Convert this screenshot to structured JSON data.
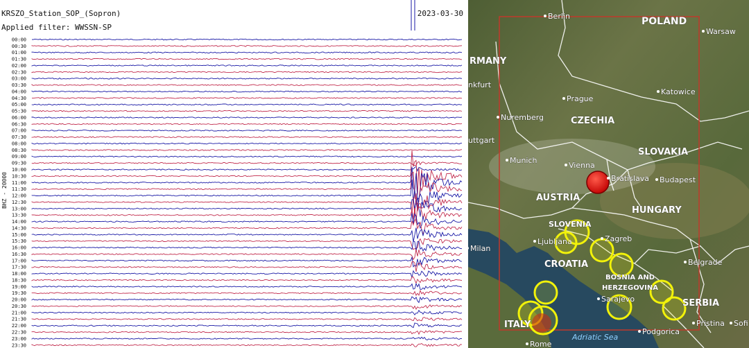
{
  "seismogram": {
    "station": "KRSZO_Station_SOP_(Sopron)",
    "filter": "Applied filter: WWSSN-SP",
    "date": "2023-03-30",
    "y_axis_label": "BHZ - 20000",
    "trace_colors": [
      "#1a1aa6",
      "#c22b4d"
    ],
    "time_labels": [
      "00:00",
      "00:30",
      "01:00",
      "01:30",
      "02:00",
      "02:30",
      "03:00",
      "03:30",
      "04:00",
      "04:30",
      "05:00",
      "05:30",
      "06:00",
      "06:30",
      "07:00",
      "07:30",
      "08:00",
      "08:30",
      "09:00",
      "09:30",
      "10:00",
      "10:30",
      "11:00",
      "11:30",
      "12:00",
      "12:30",
      "13:00",
      "13:30",
      "14:00",
      "14:30",
      "15:00",
      "15:30",
      "16:00",
      "16:30",
      "17:00",
      "17:30",
      "18:00",
      "18:30",
      "19:00",
      "19:30",
      "20:00",
      "20:30",
      "21:00",
      "21:30",
      "22:00",
      "22:30",
      "23:00",
      "23:30"
    ]
  },
  "map": {
    "countries": [
      "POLAND",
      "RMANY",
      "CZECHIA",
      "SLOVAKIA",
      "AUSTRIA",
      "HUNGARY",
      "SLOVENIA",
      "CROATIA",
      "BOSNIA AND",
      "HERZEGOVINA",
      "SERBIA",
      "ITALY"
    ],
    "cities": [
      "Berlin",
      "Warsaw",
      "Prague",
      "Katowice",
      "Nuremberg",
      "nkfurt",
      "uttgart",
      "Munich",
      "Vienna",
      "Bratislava",
      "Budapest",
      "Milan",
      "Ljubljana",
      "Zagreb",
      "Belgrade",
      "Sarajevo",
      "Podgorica",
      "Pristina",
      "Sofi",
      "Rome"
    ],
    "sea": "Adriatic Sea",
    "colors": {
      "box": "#c0392b",
      "epicenter": "#e00000",
      "circle": "#f2f20a"
    }
  }
}
